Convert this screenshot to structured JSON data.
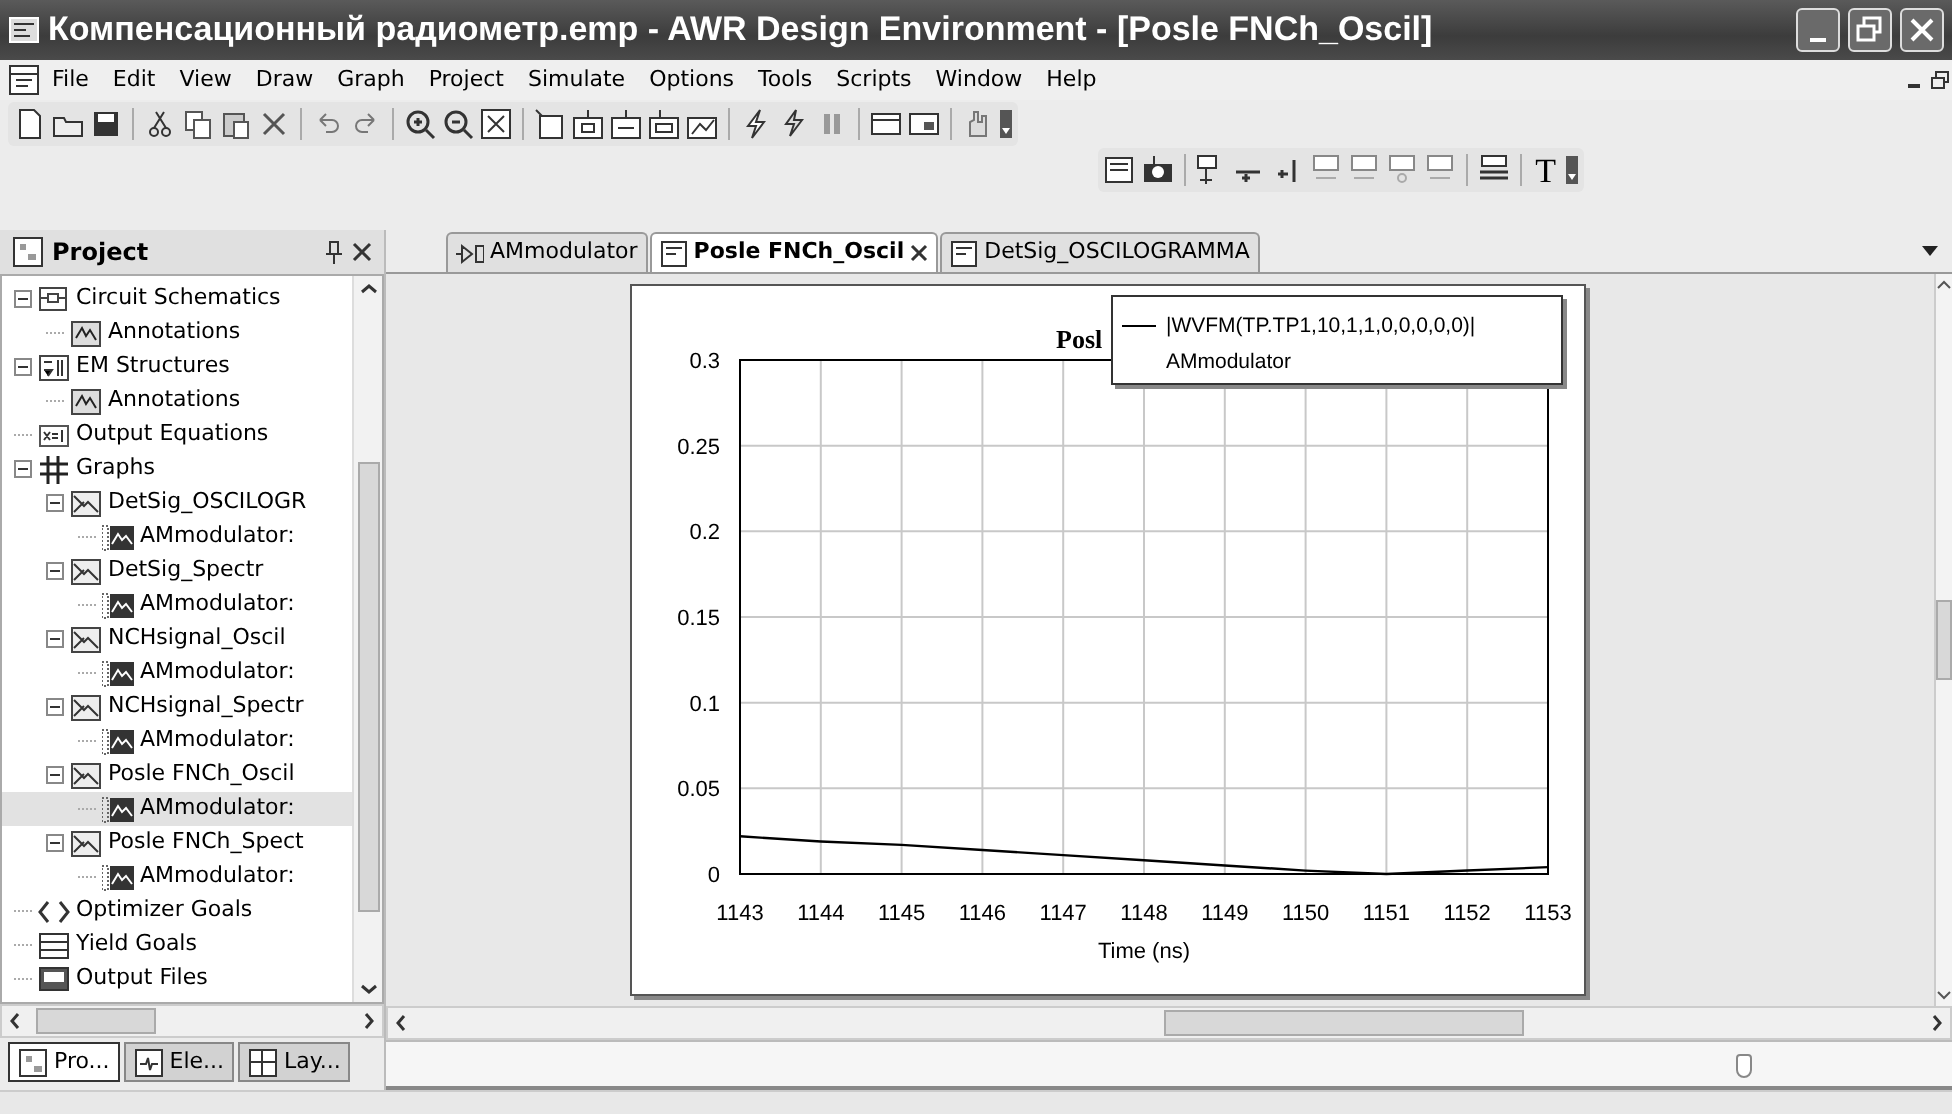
{
  "window": {
    "title": "Компенсационный радиометр.emp - AWR Design Environment - [Posle FNCh_Oscil]"
  },
  "menu": [
    "File",
    "Edit",
    "View",
    "Draw",
    "Graph",
    "Project",
    "Simulate",
    "Options",
    "Tools",
    "Scripts",
    "Window",
    "Help"
  ],
  "toolbar2_text_tool": "T",
  "project_panel": {
    "title": "Project",
    "tree": [
      {
        "label": "Circuit Schematics",
        "kind": "schematic",
        "expanded": true,
        "selected": false,
        "children": [
          {
            "label": "Annotations",
            "kind": "annotation",
            "selected": false
          }
        ]
      },
      {
        "label": "EM Structures",
        "kind": "em",
        "expanded": true,
        "selected": false,
        "children": [
          {
            "label": "Annotations",
            "kind": "annotation",
            "selected": false
          }
        ]
      },
      {
        "label": "Output Equations",
        "kind": "equation",
        "selected": false
      },
      {
        "label": "Graphs",
        "kind": "grid",
        "expanded": true,
        "selected": false,
        "children": [
          {
            "label": "DetSig_OSCILOGR",
            "kind": "graph",
            "expanded": true,
            "selected": false,
            "children": [
              {
                "label": "AMmodulator:",
                "kind": "measure",
                "selected": false
              }
            ]
          },
          {
            "label": "DetSig_Spectr",
            "kind": "graph",
            "expanded": true,
            "selected": false,
            "children": [
              {
                "label": "AMmodulator:",
                "kind": "measure",
                "selected": false
              }
            ]
          },
          {
            "label": "NCHsignal_Oscil",
            "kind": "graph",
            "expanded": true,
            "selected": false,
            "children": [
              {
                "label": "AMmodulator:",
                "kind": "measure",
                "selected": false
              }
            ]
          },
          {
            "label": "NCHsignal_Spectr",
            "kind": "graph",
            "expanded": true,
            "selected": false,
            "children": [
              {
                "label": "AMmodulator:",
                "kind": "measure",
                "selected": false
              }
            ]
          },
          {
            "label": "Posle FNCh_Oscil",
            "kind": "graph",
            "expanded": true,
            "selected": false,
            "children": [
              {
                "label": "AMmodulator:",
                "kind": "measure",
                "selected": true
              }
            ]
          },
          {
            "label": "Posle FNCh_Spect",
            "kind": "graph",
            "expanded": true,
            "selected": false,
            "children": [
              {
                "label": "AMmodulator:",
                "kind": "measure",
                "selected": false
              }
            ]
          }
        ]
      },
      {
        "label": "Optimizer Goals",
        "kind": "goal",
        "selected": false
      },
      {
        "label": "Yield Goals",
        "kind": "yield",
        "selected": false
      },
      {
        "label": "Output Files",
        "kind": "file",
        "selected": false
      }
    ],
    "bottom_tabs": [
      {
        "label": "Pro...",
        "selected": true
      },
      {
        "label": "Ele...",
        "selected": false
      },
      {
        "label": "Lay...",
        "selected": false
      }
    ]
  },
  "doc_tabs": [
    {
      "label": "AMmodulator",
      "kind": "schematic",
      "selected": false,
      "closable": false
    },
    {
      "label": "Posle FNCh_Oscil",
      "kind": "graph",
      "selected": true,
      "closable": true
    },
    {
      "label": "DetSig_OSCILOGRAMMA",
      "kind": "graph",
      "selected": false,
      "closable": false
    }
  ],
  "graph": {
    "legend": {
      "source": "AMmodulator"
    },
    "chart_data": {
      "type": "line",
      "title": "Posl",
      "xlabel": "Time (ns)",
      "grid": true,
      "x": [
        1143,
        1144,
        1145,
        1146,
        1147,
        1148,
        1149,
        1150,
        1151,
        1152,
        1153
      ],
      "series": [
        {
          "name": "|WVFM(TP.TP1,10,1,1,0,0,0,0,0)|",
          "color": "#000000",
          "values": [
            0.022,
            0.019,
            0.017,
            0.014,
            0.011,
            0.008,
            0.005,
            0.002,
            0,
            0.002,
            0.004
          ]
        }
      ],
      "xlim": [
        1143,
        1153
      ],
      "ylim": [
        0,
        0.3
      ],
      "xticks": [
        1143,
        1144,
        1145,
        1146,
        1147,
        1148,
        1149,
        1150,
        1151,
        1152,
        1153
      ],
      "yticks": [
        {
          "value": 0,
          "label": "0"
        },
        {
          "value": 0.05,
          "label": "0.05"
        },
        {
          "value": 0.1,
          "label": "0.1"
        },
        {
          "value": 0.15,
          "label": "0.15"
        },
        {
          "value": 0.2,
          "label": "0.2"
        },
        {
          "value": 0.25,
          "label": "0.25"
        },
        {
          "value": 0.3,
          "label": "0.3"
        }
      ]
    }
  }
}
